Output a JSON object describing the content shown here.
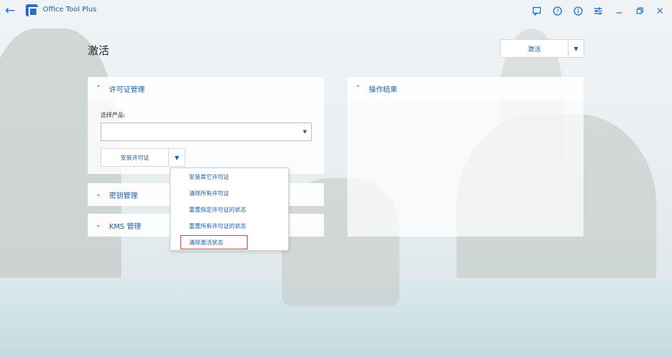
{
  "titlebar": {
    "app_title": "Office Tool Plus",
    "icons": [
      "back-arrow-icon",
      "app-logo-icon",
      "message-icon",
      "help-icon",
      "info-icon",
      "settings-icon",
      "minimize-icon",
      "restore-icon",
      "close-icon"
    ]
  },
  "page": {
    "title": "激活",
    "activate_label": "激活"
  },
  "license_panel": {
    "title": "许可证管理",
    "select_label": "选择产品:",
    "selected_value": "",
    "install_label": "安装许可证"
  },
  "dropdown": {
    "items": [
      "安装其它许可证",
      "清除所有许可证",
      "重置指定许可证的状态",
      "重置所有许可证的状态",
      "清除激活状态"
    ],
    "highlighted_index": 4
  },
  "key_panel": {
    "title": "密钥管理"
  },
  "kms_panel": {
    "title": "KMS 管理"
  },
  "result_panel": {
    "title": "操作结果"
  },
  "colors": {
    "accent": "#1b5ea8",
    "highlight": "#e53935"
  }
}
